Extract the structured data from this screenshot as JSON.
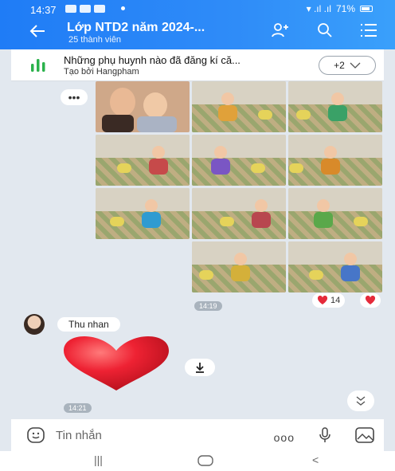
{
  "status_bar": {
    "time": "14:37",
    "battery": "71%"
  },
  "header": {
    "title": "Lớp NTD2 năm 2024-...",
    "subtitle": "25 thành viên"
  },
  "pinned": {
    "title": "Những phụ huynh nào đã đăng kí că...",
    "subtitle": "Tạo bởi Hangpham",
    "more_label": "+2"
  },
  "messages": {
    "more_label": "•••",
    "photo_time": "14:19",
    "reaction_count": "14",
    "sender_name": "Thu nhan",
    "heart_time": "14:21"
  },
  "composer": {
    "placeholder": "Tin nhắn",
    "more_label": "ooo"
  },
  "icons": [
    "back-arrow-icon",
    "add-member-icon",
    "search-icon",
    "menu-icon",
    "poll-icon",
    "chevron-down-icon",
    "heart-icon",
    "download-icon",
    "double-chevron-down-icon",
    "emoji-icon",
    "mic-icon",
    "image-icon"
  ],
  "colors": {
    "header": "#1f7cf6",
    "heart": "#e52a3a",
    "chat_bg": "#e2e8ef",
    "poll_green": "#2bb24c"
  }
}
